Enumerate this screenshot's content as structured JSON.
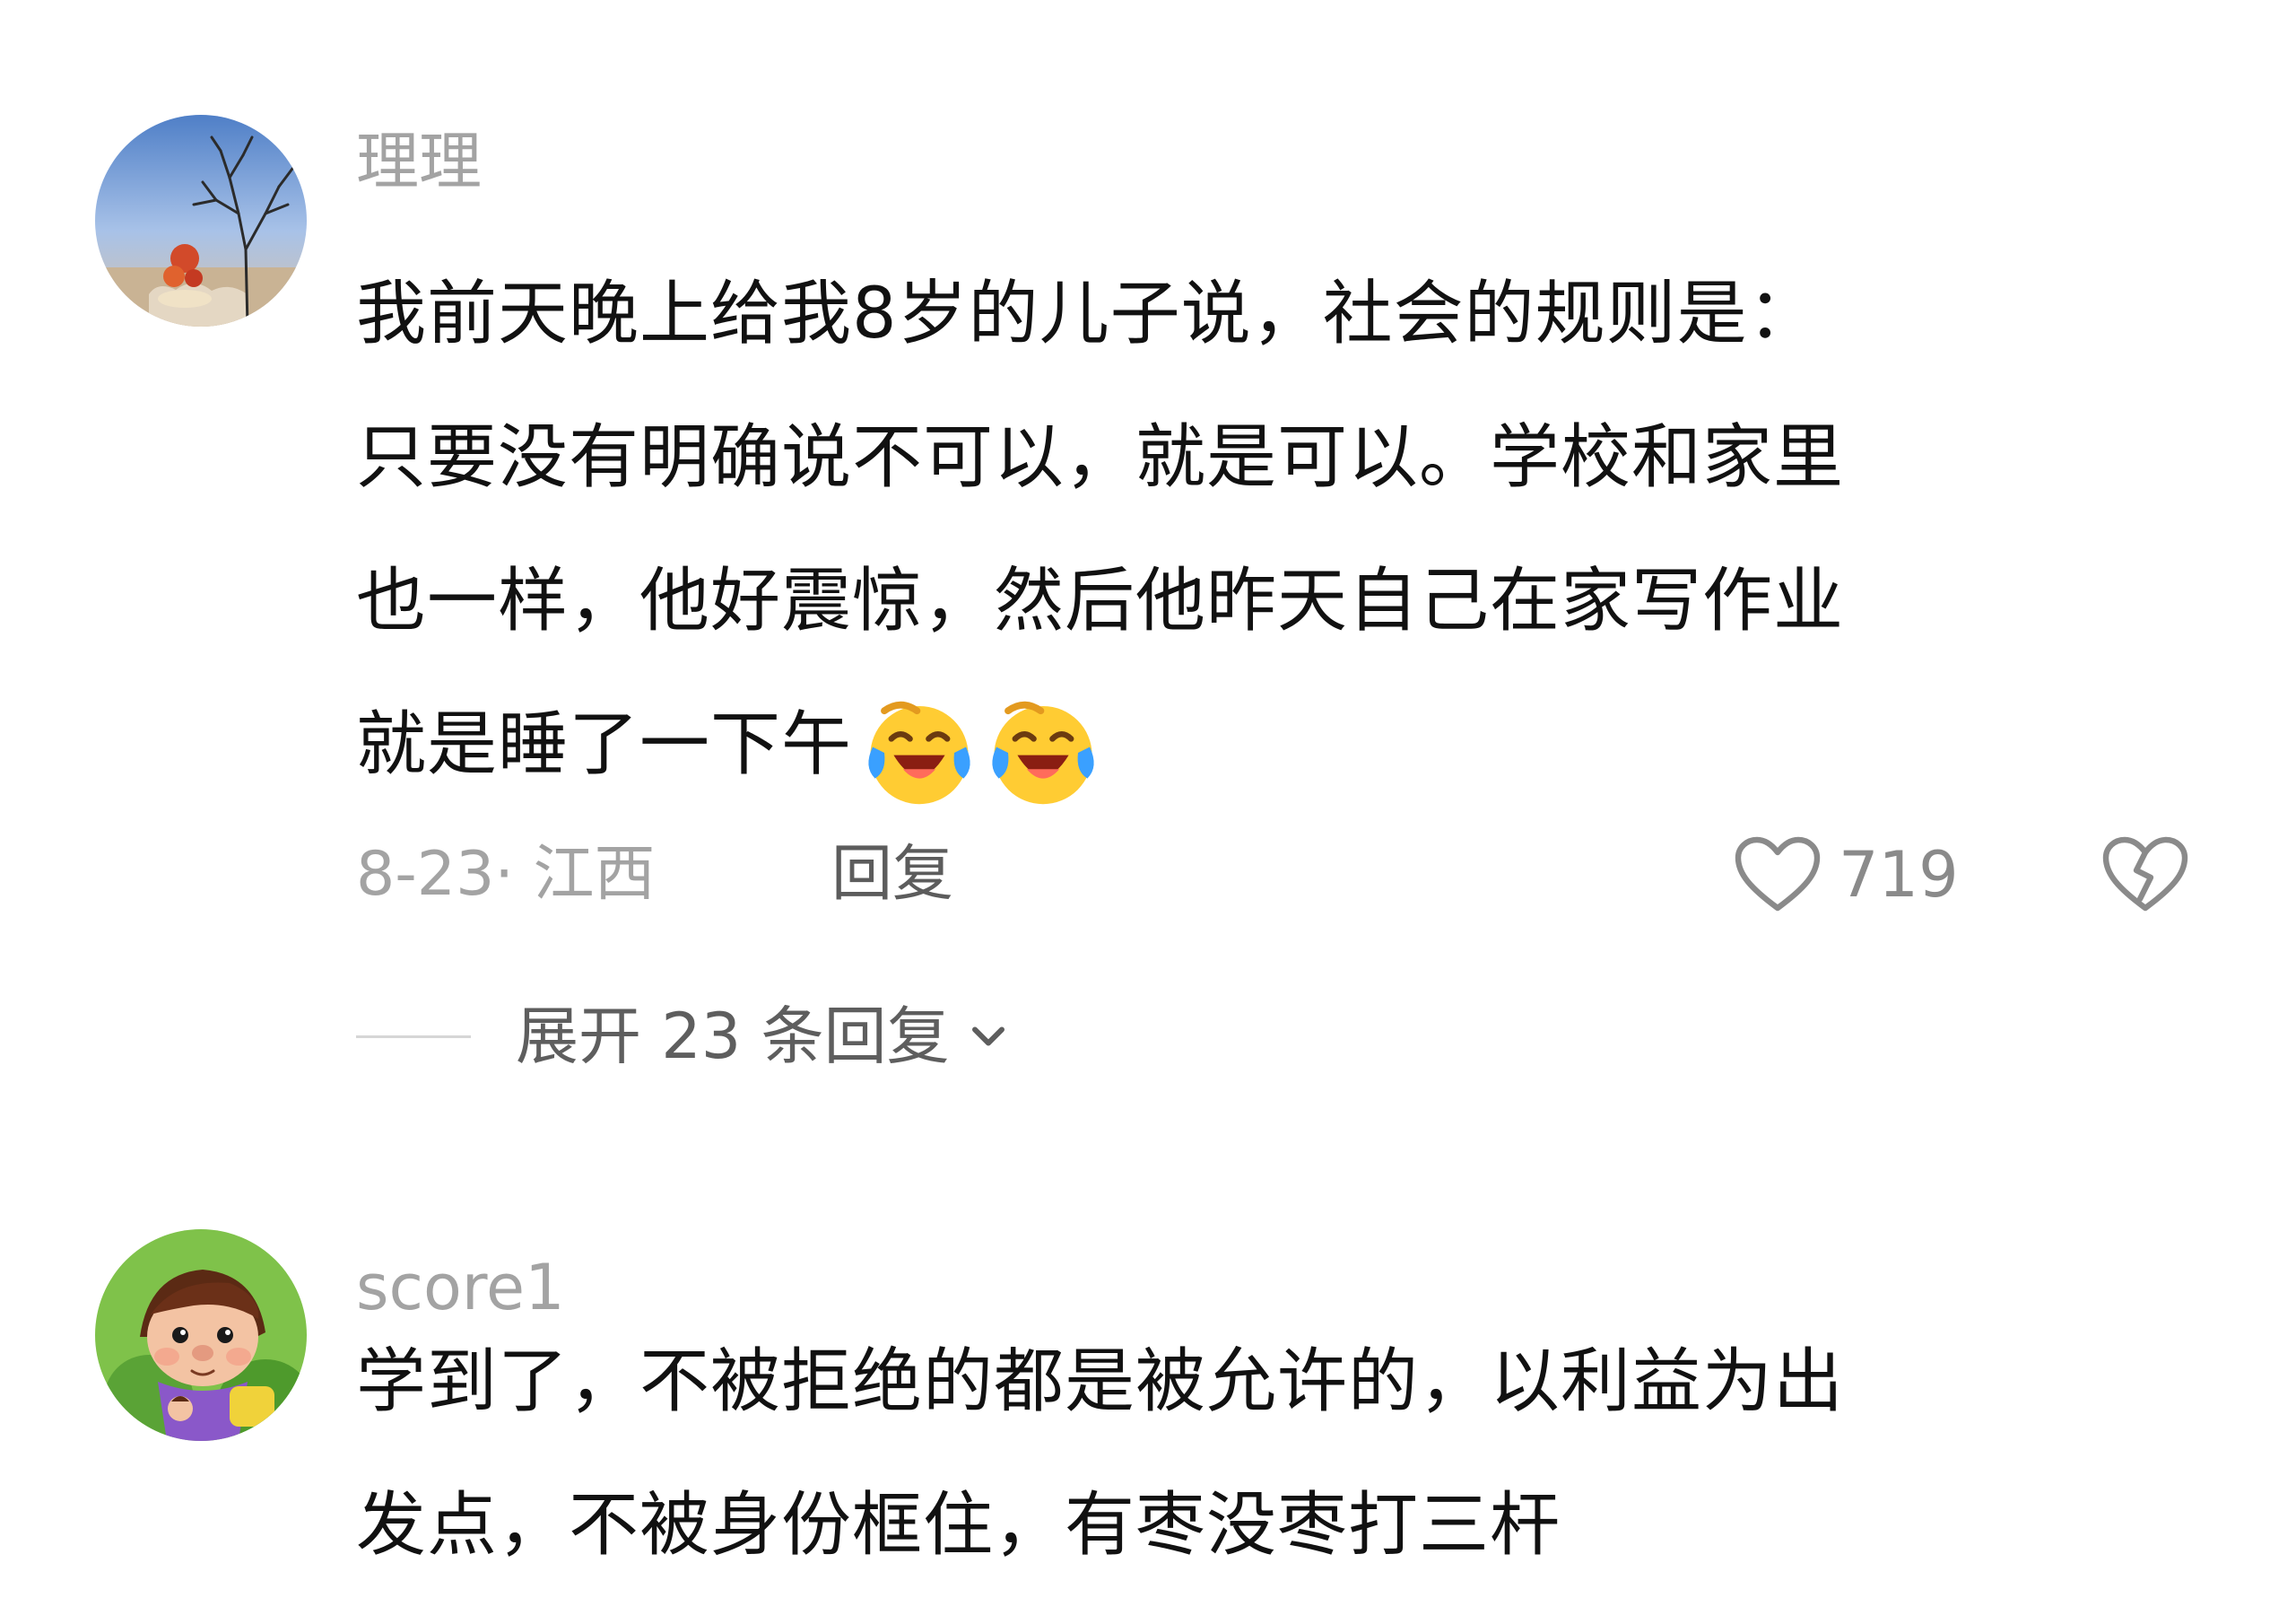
{
  "comments": [
    {
      "username": "理理",
      "avatar_icon": "tree-landscape-avatar",
      "lines": [
        "我前天晚上给我8岁的儿子说，社会的规则是：",
        "只要没有明确说不可以，就是可以。学校和家里",
        "也一样，他好震惊，然后他昨天自己在家写作业",
        "就是睡了一下午"
      ],
      "emojis": [
        "laughing-crying-emoji",
        "laughing-crying-emoji"
      ],
      "date_location": "8-23· 江西",
      "reply_label": "回复",
      "like_count": "719",
      "expand_label": "展开 23 条回复"
    },
    {
      "username": "score1",
      "avatar_icon": "cartoon-character-avatar",
      "lines": [
        "学到了，不被拒绝的都是被允许的，以利益为出",
        "发点，不被身份框住，有枣没枣打三杆"
      ]
    }
  ],
  "colors": {
    "username": "#a3a3a3",
    "body_text": "#111111",
    "meta": "#a3a3a3",
    "reply": "#5c5c5c",
    "icon": "#8a8a8a"
  }
}
